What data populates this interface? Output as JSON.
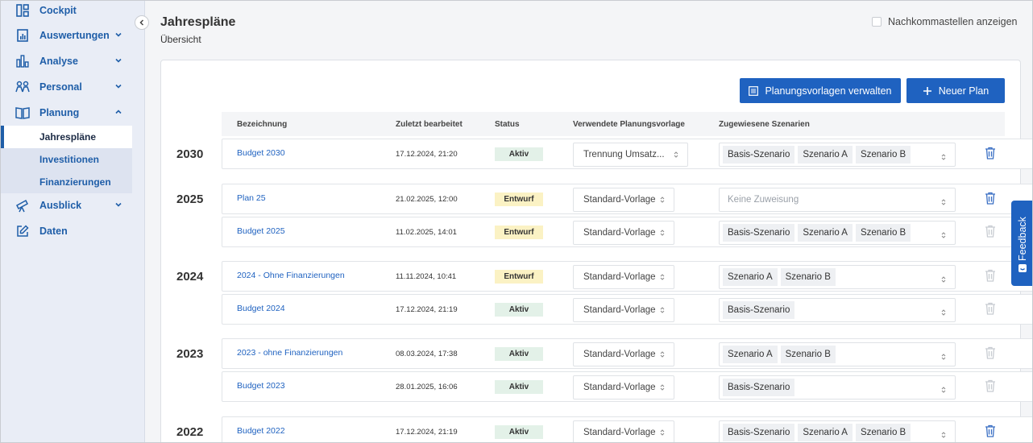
{
  "sidebar": {
    "items": [
      {
        "label": "Cockpit",
        "icon": "dashboard-icon"
      },
      {
        "label": "Auswertungen",
        "icon": "report-icon"
      },
      {
        "label": "Analyse",
        "icon": "bar-chart-icon"
      },
      {
        "label": "Personal",
        "icon": "people-icon"
      },
      {
        "label": "Planung",
        "icon": "book-icon"
      },
      {
        "label": "Ausblick",
        "icon": "telescope-icon"
      },
      {
        "label": "Daten",
        "icon": "edit-icon"
      }
    ],
    "subitems": [
      {
        "label": "Jahrespläne",
        "active": true
      },
      {
        "label": "Investitionen"
      },
      {
        "label": "Finanzierungen"
      }
    ]
  },
  "header": {
    "title": "Jahrespläne",
    "subtitle": "Übersicht",
    "decimals_label": "Nachkommastellen anzeigen"
  },
  "toolbar": {
    "templates_button": "Planungsvorlagen verwalten",
    "new_plan_button": "Neuer Plan"
  },
  "table": {
    "columns": [
      "Bezeichnung",
      "Zuletzt bearbeitet",
      "Status",
      "Verwendete Planungsvorlage",
      "Zugewiesene Szenarien"
    ],
    "placeholder_no_assignment": "Keine Zuweisung",
    "groups": [
      {
        "year": "2030",
        "rows": [
          {
            "name": "Budget 2030",
            "edited": "17.12.2024, 21:20",
            "status": "Aktiv",
            "template": "Trennung Umsatz...",
            "scenarios": [
              "Basis-Szenario",
              "Szenario A",
              "Szenario B"
            ],
            "delete_enabled": true
          }
        ]
      },
      {
        "year": "2025",
        "rows": [
          {
            "name": "Plan 25",
            "edited": "21.02.2025, 12:00",
            "status": "Entwurf",
            "template": "Standard-Vorlage",
            "scenarios": [],
            "delete_enabled": true
          },
          {
            "name": "Budget 2025",
            "edited": "11.02.2025, 14:01",
            "status": "Entwurf",
            "template": "Standard-Vorlage",
            "scenarios": [
              "Basis-Szenario",
              "Szenario A",
              "Szenario B"
            ],
            "delete_enabled": false
          }
        ]
      },
      {
        "year": "2024",
        "rows": [
          {
            "name": "2024 - Ohne Finanzierungen",
            "edited": "11.11.2024, 10:41",
            "status": "Entwurf",
            "template": "Standard-Vorlage",
            "scenarios": [
              "Szenario A",
              "Szenario B"
            ],
            "delete_enabled": false
          },
          {
            "name": "Budget 2024",
            "edited": "17.12.2024, 21:19",
            "status": "Aktiv",
            "template": "Standard-Vorlage",
            "scenarios": [
              "Basis-Szenario"
            ],
            "delete_enabled": false
          }
        ]
      },
      {
        "year": "2023",
        "rows": [
          {
            "name": "2023 - ohne Finanzierungen",
            "edited": "08.03.2024, 17:38",
            "status": "Aktiv",
            "template": "Standard-Vorlage",
            "scenarios": [
              "Szenario A",
              "Szenario B"
            ],
            "delete_enabled": false
          },
          {
            "name": "Budget 2023",
            "edited": "28.01.2025, 16:06",
            "status": "Aktiv",
            "template": "Standard-Vorlage",
            "scenarios": [
              "Basis-Szenario"
            ],
            "delete_enabled": false
          }
        ]
      },
      {
        "year": "2022",
        "rows": [
          {
            "name": "Budget 2022",
            "edited": "17.12.2024, 21:19",
            "status": "Aktiv",
            "template": "Standard-Vorlage",
            "scenarios": [
              "Basis-Szenario",
              "Szenario A",
              "Szenario B"
            ],
            "delete_enabled": true
          }
        ]
      }
    ]
  },
  "feedback": {
    "label": "Feedback"
  },
  "colors": {
    "accent": "#1f62c0",
    "active_bg": "#e3f1e8",
    "draft_bg": "#fbf2c4",
    "sidebar_bg": "#e9edf6"
  }
}
